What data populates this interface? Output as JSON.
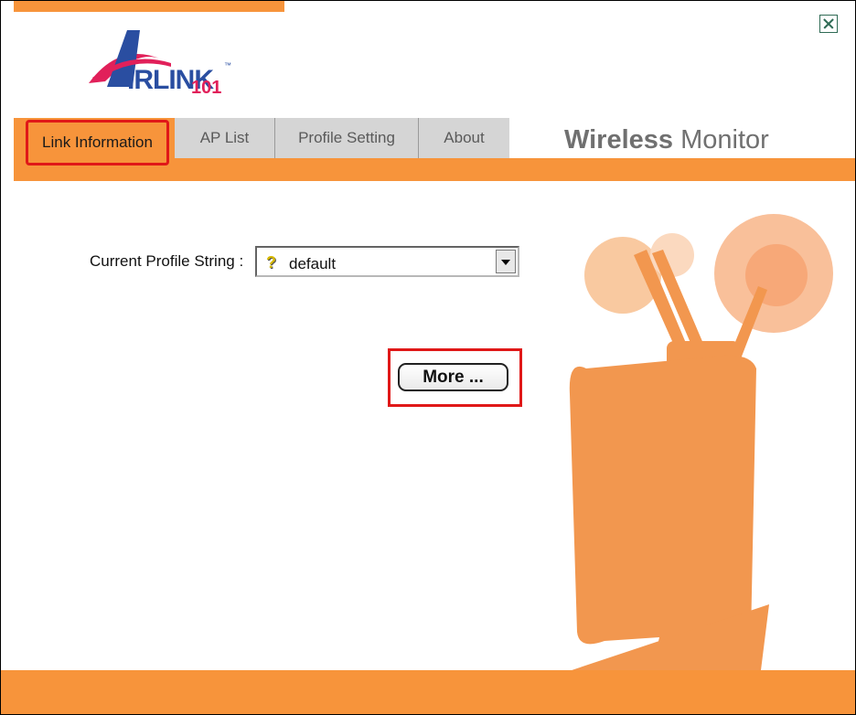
{
  "logo": {
    "wordmark": "IRLINK",
    "tm": "™",
    "number": "101"
  },
  "tabs": [
    {
      "label": "Link Information",
      "active": true
    },
    {
      "label": "AP List",
      "active": false
    },
    {
      "label": "Profile Setting",
      "active": false
    },
    {
      "label": "About",
      "active": false
    }
  ],
  "brand": {
    "bold": "Wireless",
    "light": " Monitor"
  },
  "profile": {
    "label": "Current Profile String :",
    "value": "default",
    "icon": "question-icon"
  },
  "more_button": {
    "label": "More ..."
  },
  "colors": {
    "accent": "#f7943b",
    "highlight": "#e01818",
    "logo_blue": "#2a4ea1",
    "logo_pink": "#e1205a"
  }
}
